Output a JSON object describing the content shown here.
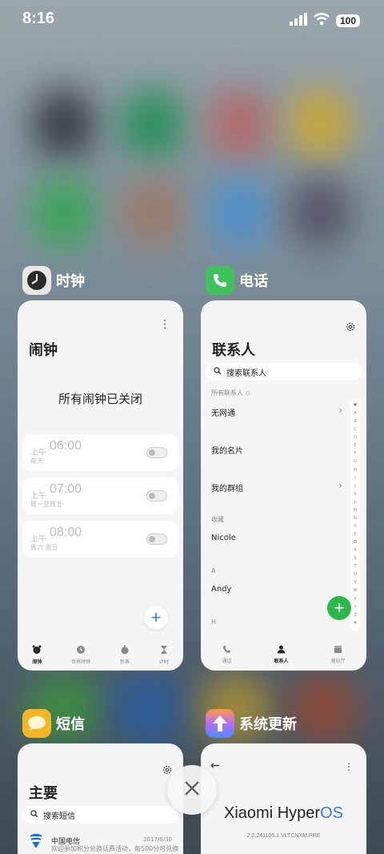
{
  "status_bar": {
    "time": "8:16",
    "battery": "100"
  },
  "apps": {
    "clock": {
      "name": "时钟",
      "title": "闹钟",
      "status": "所有闹钟已关闭",
      "alarms": [
        {
          "ampm": "上午",
          "time": "06:00",
          "repeat": "每天"
        },
        {
          "ampm": "上午",
          "time": "07:00",
          "repeat": "周一至周五"
        },
        {
          "ampm": "上午",
          "time": "08:00",
          "repeat": "周六 周日"
        }
      ],
      "nav": [
        "闹钟",
        "世界时钟",
        "秒表",
        "计时"
      ]
    },
    "phone": {
      "name": "电话",
      "title": "联系人",
      "search_placeholder": "搜索联系人",
      "all_label": "所有联系人 ◇",
      "rows": [
        "无网通",
        "我的名片",
        "我的群组"
      ],
      "favorites_label": "收藏",
      "favorite": "Nicole",
      "section_a": "A",
      "contact_a": "Andy",
      "section_h": "H",
      "alphabet": [
        "♥",
        "A",
        "B",
        "C",
        "D",
        "E",
        "F",
        "G",
        "H",
        "I",
        "J",
        "K",
        "L",
        "M",
        "N",
        "O",
        "P",
        "Q",
        "R",
        "S",
        "T",
        "U",
        "V",
        "W",
        "X",
        "Y",
        "Z",
        "#"
      ],
      "nav": [
        "通话",
        "联系人",
        "营业厅"
      ]
    },
    "sms": {
      "name": "短信",
      "title": "主要",
      "search_placeholder": "搜索短信",
      "message": {
        "sender": "中国电信",
        "date": "2017/6/30",
        "preview": "欢迎参加积分兑换话费活动，每500分可兑换"
      }
    },
    "update": {
      "name": "系统更新",
      "os_name_main": "Xiaomi Hyper",
      "os_name_accent": "OS",
      "version": "2.0.241105.1.VLTCNXM.PRE"
    }
  },
  "colors": {
    "accent_blue": "#2f7de1",
    "green": "#2db84d",
    "os_accent": "#2f7de1"
  }
}
